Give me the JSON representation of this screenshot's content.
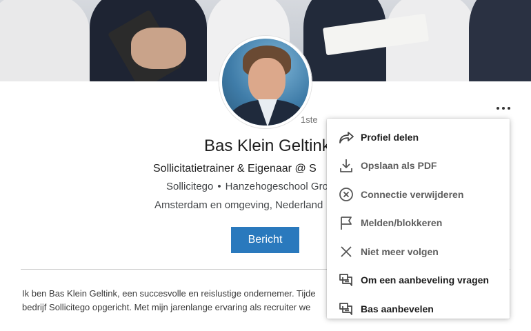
{
  "profile": {
    "name": "Bas Klein Geltink",
    "degree": "1ste",
    "headline": "Sollicitatietrainer & Eigenaar @ S",
    "company": "Sollicitego",
    "separator": "•",
    "education": "Hanzehogeschool Gro",
    "location": "Amsterdam en omgeving, Nederland",
    "message_button": "Bericht",
    "summary_lines": [
      "Ik ben Bas Klein Geltink, een succesvolle en reislustige ondernemer. Tijde",
      "bedrijf Sollicitego opgericht. Met mijn jarenlange ervaring als recruiter we"
    ]
  },
  "menu": {
    "items": [
      {
        "label": "Profiel delen",
        "icon": "share-icon"
      },
      {
        "label": "Opslaan als PDF",
        "icon": "download-icon"
      },
      {
        "label": "Connectie verwijderen",
        "icon": "remove-connection-icon"
      },
      {
        "label": "Melden/blokkeren",
        "icon": "flag-icon"
      },
      {
        "label": "Niet meer volgen",
        "icon": "close-icon"
      },
      {
        "label": "Om een aanbeveling vragen",
        "icon": "recommendation-icon"
      },
      {
        "label": "Bas aanbevelen",
        "icon": "recommendation-icon"
      }
    ]
  },
  "colors": {
    "accent": "#2a79bd",
    "text_primary": "#1d1d1d",
    "text_muted": "#5e5e5e"
  }
}
